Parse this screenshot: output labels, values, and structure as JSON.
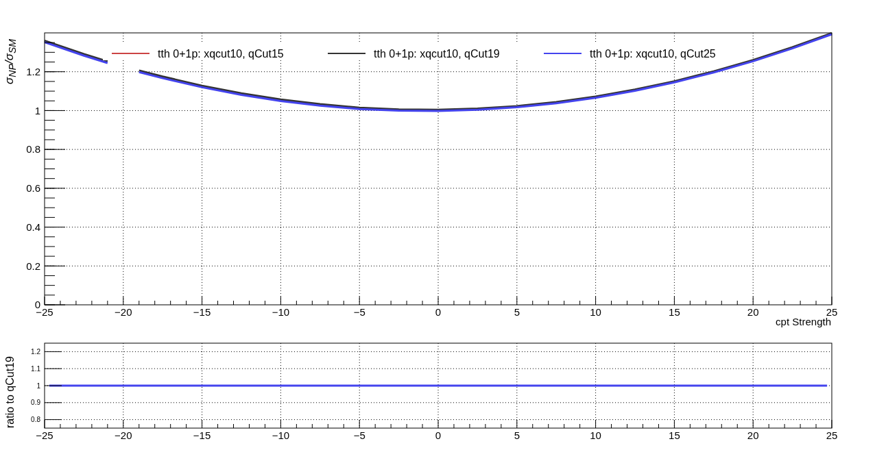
{
  "charts": [
    {
      "kind": "main",
      "chart_data": {
        "type": "line",
        "xlabel": "cpt Strength",
        "ylabel": "σ$_{NP}$/σ$_{SM}$",
        "grid": true,
        "legend": true,
        "x": [
          -25,
          -22.5,
          -21,
          -20,
          -19,
          -17.5,
          -15,
          -12.5,
          -10,
          -7.5,
          -5,
          -2.5,
          0,
          2.5,
          5,
          7.5,
          10,
          12.5,
          15,
          17.5,
          20,
          22.5,
          25
        ],
        "series": [
          {
            "name": "tth 0+1p: xqcut10, qCut15",
            "color": "#cc4444",
            "values": [
              null,
              null,
              null,
              null,
              null,
              null,
              null,
              null,
              null,
              null,
              null,
              null,
              null,
              null,
              null,
              null,
              null,
              null,
              null,
              null,
              null,
              null,
              null
            ]
          },
          {
            "name": "tth 0+1p: xqcut10, qCut19",
            "color": "#333333",
            "values": [
              1.36,
              1.291,
              1.253,
              null,
              1.206,
              1.175,
              1.128,
              1.089,
              1.057,
              1.033,
              1.015,
              1.006,
              1.004,
              1.01,
              1.023,
              1.044,
              1.072,
              1.108,
              1.151,
              1.202,
              1.26,
              1.326,
              1.399
            ]
          },
          {
            "name": "tth 0+1p: xqcut10, qCut25",
            "color": "#4444ee",
            "values": [
              1.352,
              1.283,
              1.245,
              null,
              1.198,
              1.167,
              1.12,
              1.081,
              1.049,
              1.025,
              1.008,
              1.0,
              0.998,
              1.004,
              1.017,
              1.038,
              1.066,
              1.102,
              1.145,
              1.196,
              1.254,
              1.32,
              1.393
            ]
          }
        ],
        "xlim": [
          -25,
          25
        ],
        "ylim": [
          0,
          1.4
        ],
        "xticks": [
          {
            "value": -25,
            "label": "−25"
          },
          {
            "value": -20,
            "label": "−20"
          },
          {
            "value": -15,
            "label": "−15"
          },
          {
            "value": -10,
            "label": "−10"
          },
          {
            "value": -5,
            "label": "−5"
          },
          0,
          5,
          10,
          15,
          20,
          25
        ],
        "yticks": [
          0,
          0.2,
          0.4,
          0.6,
          0.8,
          1,
          1.2
        ]
      }
    },
    {
      "kind": "ratio",
      "chart_data": {
        "type": "line",
        "ylabel": "ratio to qCut19",
        "grid": true,
        "x": [
          -24.7,
          -15,
          -5,
          0,
          5,
          15,
          24.7
        ],
        "series": [
          {
            "color": "#4444ee",
            "values": [
              1,
              1,
              1,
              1,
              1,
              1,
              1
            ]
          }
        ],
        "xlim": [
          -25,
          25
        ],
        "ylim": [
          0.75,
          1.25
        ],
        "xticks": [
          {
            "value": -25,
            "label": "−25"
          },
          {
            "value": -20,
            "label": "−20"
          },
          {
            "value": -15,
            "label": "−15"
          },
          {
            "value": -10,
            "label": "−10"
          },
          {
            "value": -5,
            "label": "−5"
          },
          0,
          5,
          10,
          15,
          20,
          25
        ],
        "yticks": [
          0.8,
          0.9,
          1,
          1.1,
          1.2
        ]
      }
    }
  ]
}
